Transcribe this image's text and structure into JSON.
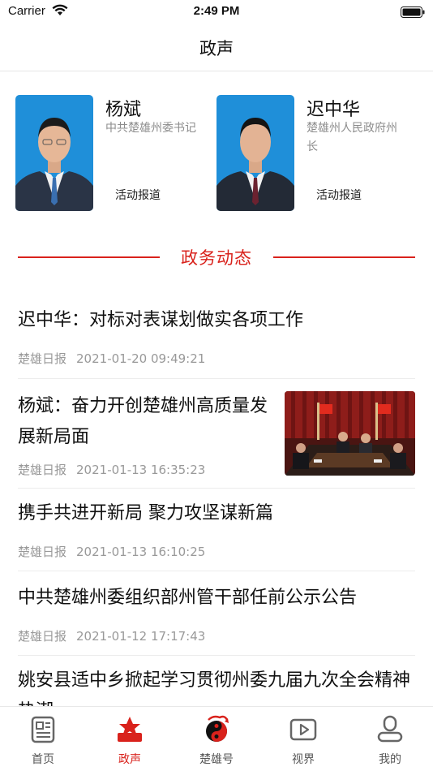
{
  "status_bar": {
    "carrier": "Carrier",
    "time": "2:49 PM"
  },
  "nav": {
    "title": "政声"
  },
  "leaders": [
    {
      "name": "杨斌",
      "title": "中共楚雄州委书记",
      "action": "活动报道"
    },
    {
      "name": "迟中华",
      "title": "楚雄州人民政府州长",
      "action": "活动报道"
    }
  ],
  "section": {
    "title": "政务动态"
  },
  "news": [
    {
      "title": "迟中华：对标对表谋划做实各项工作",
      "source": "楚雄日报",
      "time": "2021-01-20 09:49:21"
    },
    {
      "title": "杨斌：奋力开创楚雄州高质量发展新局面",
      "source": "楚雄日报",
      "time": "2021-01-13 16:35:23"
    },
    {
      "title": "携手共进开新局 聚力攻坚谋新篇",
      "source": "楚雄日报",
      "time": "2021-01-13 16:10:25"
    },
    {
      "title": "中共楚雄州委组织部州管干部任前公示公告",
      "source": "楚雄日报",
      "time": "2021-01-12 17:17:43"
    },
    {
      "title": "姚安县适中乡掀起学习贯彻州委九届九次全会精神热潮",
      "source": "",
      "time": ""
    }
  ],
  "tabs": [
    {
      "label": "首页",
      "icon": "home-news-icon",
      "active": false
    },
    {
      "label": "政声",
      "icon": "government-icon",
      "active": true
    },
    {
      "label": "楚雄号",
      "icon": "chuxiong-logo-icon",
      "active": false
    },
    {
      "label": "视界",
      "icon": "video-play-icon",
      "active": false
    },
    {
      "label": "我的",
      "icon": "profile-icon",
      "active": false
    }
  ],
  "colors": {
    "accent": "#d9221c",
    "tab_inactive": "#555555",
    "meta_gray": "#999999"
  }
}
